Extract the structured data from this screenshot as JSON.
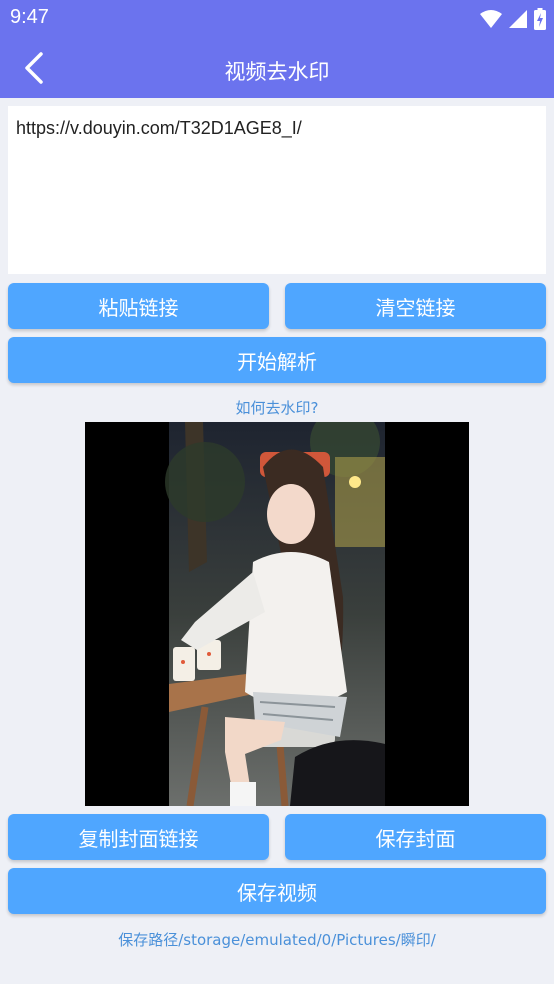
{
  "status_bar": {
    "time": "9:47",
    "icons": [
      "wifi-icon",
      "signal-icon",
      "battery-icon"
    ]
  },
  "app_bar": {
    "title": "视频去水印",
    "back_icon": "chevron-left-icon"
  },
  "url_input": {
    "value": "https://v.douyin.com/T32D1AGE8_I/"
  },
  "buttons": {
    "paste": "粘贴链接",
    "clear": "清空链接",
    "parse": "开始解析",
    "copy_cover": "复制封面链接",
    "save_cover": "保存封面",
    "save_video": "保存视频"
  },
  "help_link": "如何去水印?",
  "save_path": "保存路径/storage/emulated/0/Pictures/瞬印/",
  "colors": {
    "header": "#6b73ee",
    "button": "#4fa6ff",
    "link": "#4a90d9",
    "background": "#eef0f6"
  }
}
